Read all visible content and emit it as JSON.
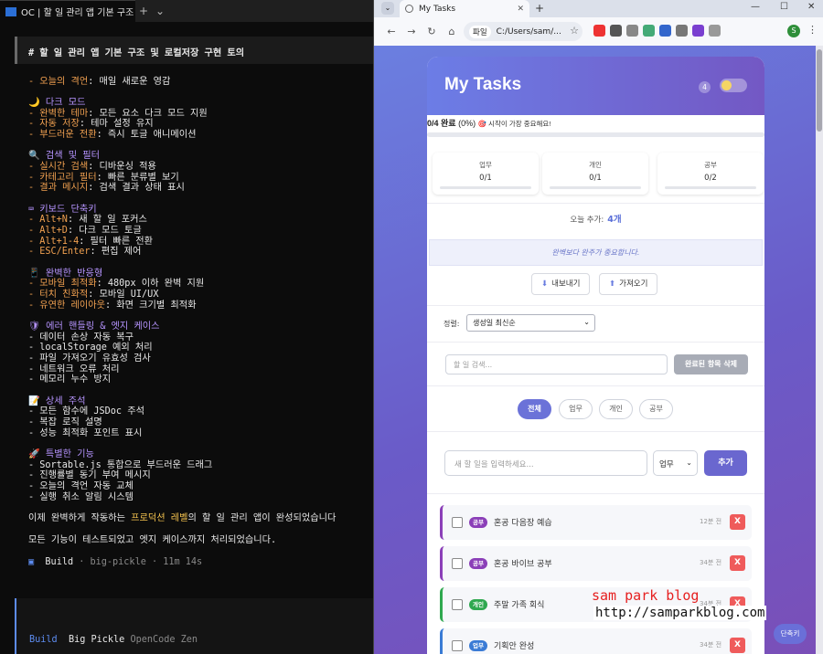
{
  "terminal": {
    "tab_title": "OC | 할 일 관리 앱 기본 구조 및",
    "header": "# 할 일 관리 앱 기본 구조 및 로컬저장 구현 토의",
    "quote_line": {
      "key": "- 오늘의 격언",
      "val": ": 매일 새로운 영감"
    },
    "sections": [
      {
        "title": "🌙 다크 모드",
        "items": [
          {
            "key": "- 완벽한 테마",
            "val": ": 모든 요소 다크 모드 지원"
          },
          {
            "key": "- 자동 저장",
            "val": ": 테마 설정 유지"
          },
          {
            "key": "- 부드러운 전환",
            "val": ": 즉시 토글 애니메이션"
          }
        ]
      },
      {
        "title": "🔍 검색 및 필터",
        "items": [
          {
            "key": "- 실시간 검색",
            "val": ": 디바운싱 적용"
          },
          {
            "key": "- 카테고리 필터",
            "val": ": 빠른 분류별 보기"
          },
          {
            "key": "- 결과 메시지",
            "val": ": 검색 결과 상태 표시"
          }
        ]
      },
      {
        "title": "⌨ 키보드 단축키",
        "items": [
          {
            "key": "- Alt+N",
            "val": ": 새 할 일 포커스"
          },
          {
            "key": "- Alt+D",
            "val": ": 다크 모드 토글"
          },
          {
            "key": "- Alt+1-4",
            "val": ": 필터 빠른 전환"
          },
          {
            "key": "- ESC/Enter",
            "val": ": 편집 제어"
          }
        ]
      },
      {
        "title": "📱 완벽한 반응형",
        "items": [
          {
            "key": "- 모바일 최적화",
            "val": ": 480px 이하 완벽 지원"
          },
          {
            "key": "- 터치 친화적",
            "val": ": 모바일 UI/UX"
          },
          {
            "key": "- 유연한 레이아웃",
            "val": ": 화면 크기별 최적화"
          }
        ]
      },
      {
        "title": "🛡 에러 핸들링 & 엣지 케이스",
        "items": [
          {
            "key": "",
            "val": "- 데이터 손상 자동 복구"
          },
          {
            "key": "",
            "val": "- localStorage 예외 처리"
          },
          {
            "key": "",
            "val": "- 파일 가져오기 유효성 검사"
          },
          {
            "key": "",
            "val": "- 네트워크 오류 처리"
          },
          {
            "key": "",
            "val": "- 메모리 누수 방지"
          }
        ]
      },
      {
        "title": "📝 상세 주석",
        "items": [
          {
            "key": "",
            "val": "- 모든 함수에 JSDoc 주석"
          },
          {
            "key": "",
            "val": "- 복잡 로직 설명"
          },
          {
            "key": "",
            "val": "- 성능 최적화 포인트 표시"
          }
        ]
      },
      {
        "title": "🚀 특별한 기능",
        "items": [
          {
            "key": "",
            "val": "- Sortable.js 통합으로 부드러운 드래그"
          },
          {
            "key": "",
            "val": "- 진행률별 동기 부여 메시지"
          },
          {
            "key": "",
            "val": "- 오늘의 격언 자동 교체"
          },
          {
            "key": "",
            "val": "- 실행 취소 알림 시스템"
          }
        ]
      }
    ],
    "summary_pre": "이제 완벽하게 작동하는 ",
    "summary_hl": "프로덕션 레벨",
    "summary_post": "의 할 일 관리 앱이 완성되었습니다",
    "summary2": "모든 기능이 테스트되었고 엣지 케이스까지 처리되었습니다.",
    "build_label": "Build",
    "build_meta": "· big-pickle · 11m 14s",
    "status_mode": "Build",
    "status_model": "Big Pickle",
    "status_provider": "OpenCode Zen"
  },
  "browser": {
    "tab_title": "My Tasks",
    "url_chip": "파일",
    "url": "C:/Users/sam/...",
    "profile_initial": "S"
  },
  "app": {
    "title": "My Tasks",
    "count_badge": "4",
    "progress_label": "0/4 완료",
    "progress_pct": "(0%)",
    "progress_msg": "🎯 시작이 가장 중요해요!",
    "progress_fraction": 0,
    "categories": [
      {
        "name": "업무",
        "value": "0/1"
      },
      {
        "name": "개인",
        "value": "0/1"
      },
      {
        "name": "공부",
        "value": "0/2"
      }
    ],
    "today_label": "오늘 추가:",
    "today_count": "4개",
    "quote": "완벽보다 완주가 중요합니다.",
    "export_label": "내보내기",
    "import_label": "가져오기",
    "sort_label": "정렬:",
    "sort_value": "생성일 최신순",
    "search_placeholder": "할 일 검색...",
    "clear_done_label": "완료된 항목 삭제",
    "filters": [
      "전체",
      "업무",
      "개인",
      "공부"
    ],
    "new_placeholder": "새 할 일을 입력하세요...",
    "new_category": "업무",
    "add_label": "추가",
    "tasks": [
      {
        "tag": "공부",
        "text": "혼공 다음장 예습",
        "time": "12분 전",
        "color": "#8b3fb8"
      },
      {
        "tag": "공부",
        "text": "혼공 바이브 공부",
        "time": "34분 전",
        "color": "#8b3fb8"
      },
      {
        "tag": "개인",
        "text": "주말 가족 회식",
        "time": "34분 전",
        "color": "#2fa84f"
      },
      {
        "tag": "업무",
        "text": "기획안 완성",
        "time": "34분 전",
        "color": "#3a7bd5"
      }
    ],
    "delete_label": "X",
    "shortcut_label": "단축키"
  },
  "watermark": {
    "line1": "sam park blog",
    "line2": "http://samparkblog.com"
  }
}
